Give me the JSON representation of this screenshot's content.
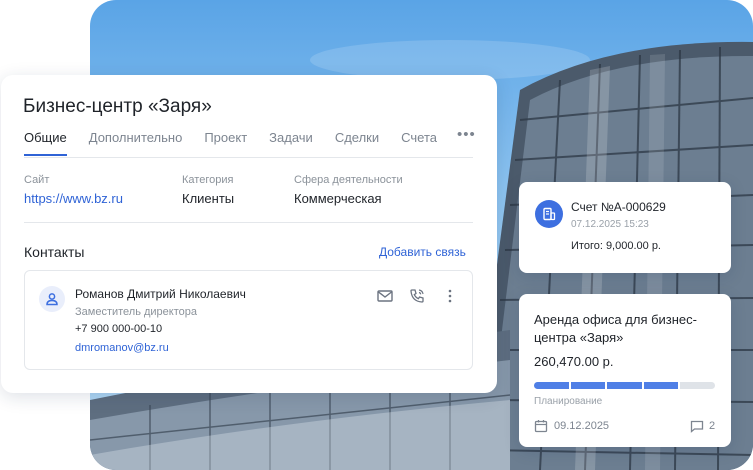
{
  "company": {
    "title": "Бизнес-центр «Заря»",
    "tabs": [
      "Общие",
      "Дополнительно",
      "Проект",
      "Задачи",
      "Сделки",
      "Счета"
    ],
    "active_tab": "Общие",
    "more_glyph": "•••",
    "fields": {
      "site": {
        "label": "Сайт",
        "value": "https://www.bz.ru"
      },
      "category": {
        "label": "Категория",
        "value": "Клиенты"
      },
      "sphere": {
        "label": "Сфера деятельности",
        "value": "Коммерческая"
      }
    },
    "contacts": {
      "title": "Контакты",
      "add_link": "Добавить связь",
      "items": [
        {
          "name": "Романов Дмитрий Николаевич",
          "role": "Заместитель директора",
          "phone": "+7 900 000-00-10",
          "email": "dmromanov@bz.ru",
          "icons": [
            "user-icon",
            "mail-icon",
            "phone-icon",
            "more-vertical-icon"
          ]
        }
      ]
    }
  },
  "invoice": {
    "title": "Счет №А-000629",
    "datetime": "07.12.2025 15:23",
    "total": "Итого: 9,000.00 р.",
    "icon": "document-icon"
  },
  "deal": {
    "title": "Аренда офиса для бизнес-центра «Заря»",
    "amount": "260,470.00 р.",
    "progress_segments_total": 5,
    "progress_segments_filled": 4,
    "stage": "Планирование",
    "date": "09.12.2025",
    "comments_count": "2",
    "icons": [
      "calendar-icon",
      "comment-icon"
    ]
  },
  "colors": {
    "accent": "#2f63d6",
    "progress_fill": "#4f7fe6",
    "progress_empty": "#dfe3e8",
    "sky": "#8cc3f0"
  }
}
